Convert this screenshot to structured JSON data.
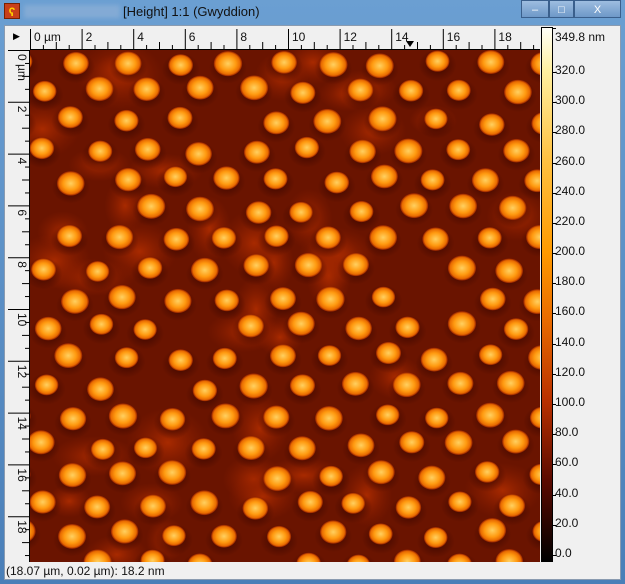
{
  "window": {
    "title": "[Height] 1:1 (Gwyddion)",
    "minimize": "‒",
    "maximize": "□",
    "close": "X",
    "app_icon": "gwyddion-icon"
  },
  "ruler_h": {
    "unit_label": "0 µm",
    "labels": [
      "2",
      "4",
      "6",
      "8",
      "10",
      "12",
      "14",
      "16",
      "18"
    ]
  },
  "ruler_v": {
    "unit_label": "0 µm",
    "labels": [
      "2",
      "4",
      "6",
      "8",
      "10",
      "12",
      "14",
      "16",
      "18"
    ]
  },
  "colorscale": {
    "max": "349.8 nm",
    "labels": [
      "320.0",
      "300.0",
      "280.0",
      "260.0",
      "240.0",
      "220.0",
      "200.0",
      "180.0",
      "160.0",
      "140.0",
      "120.0",
      "100.0",
      "80.0",
      "60.0",
      "40.0",
      "20.0",
      "0.0"
    ]
  },
  "status": "(18.07 µm, 0.02 µm): 18.2 nm"
}
